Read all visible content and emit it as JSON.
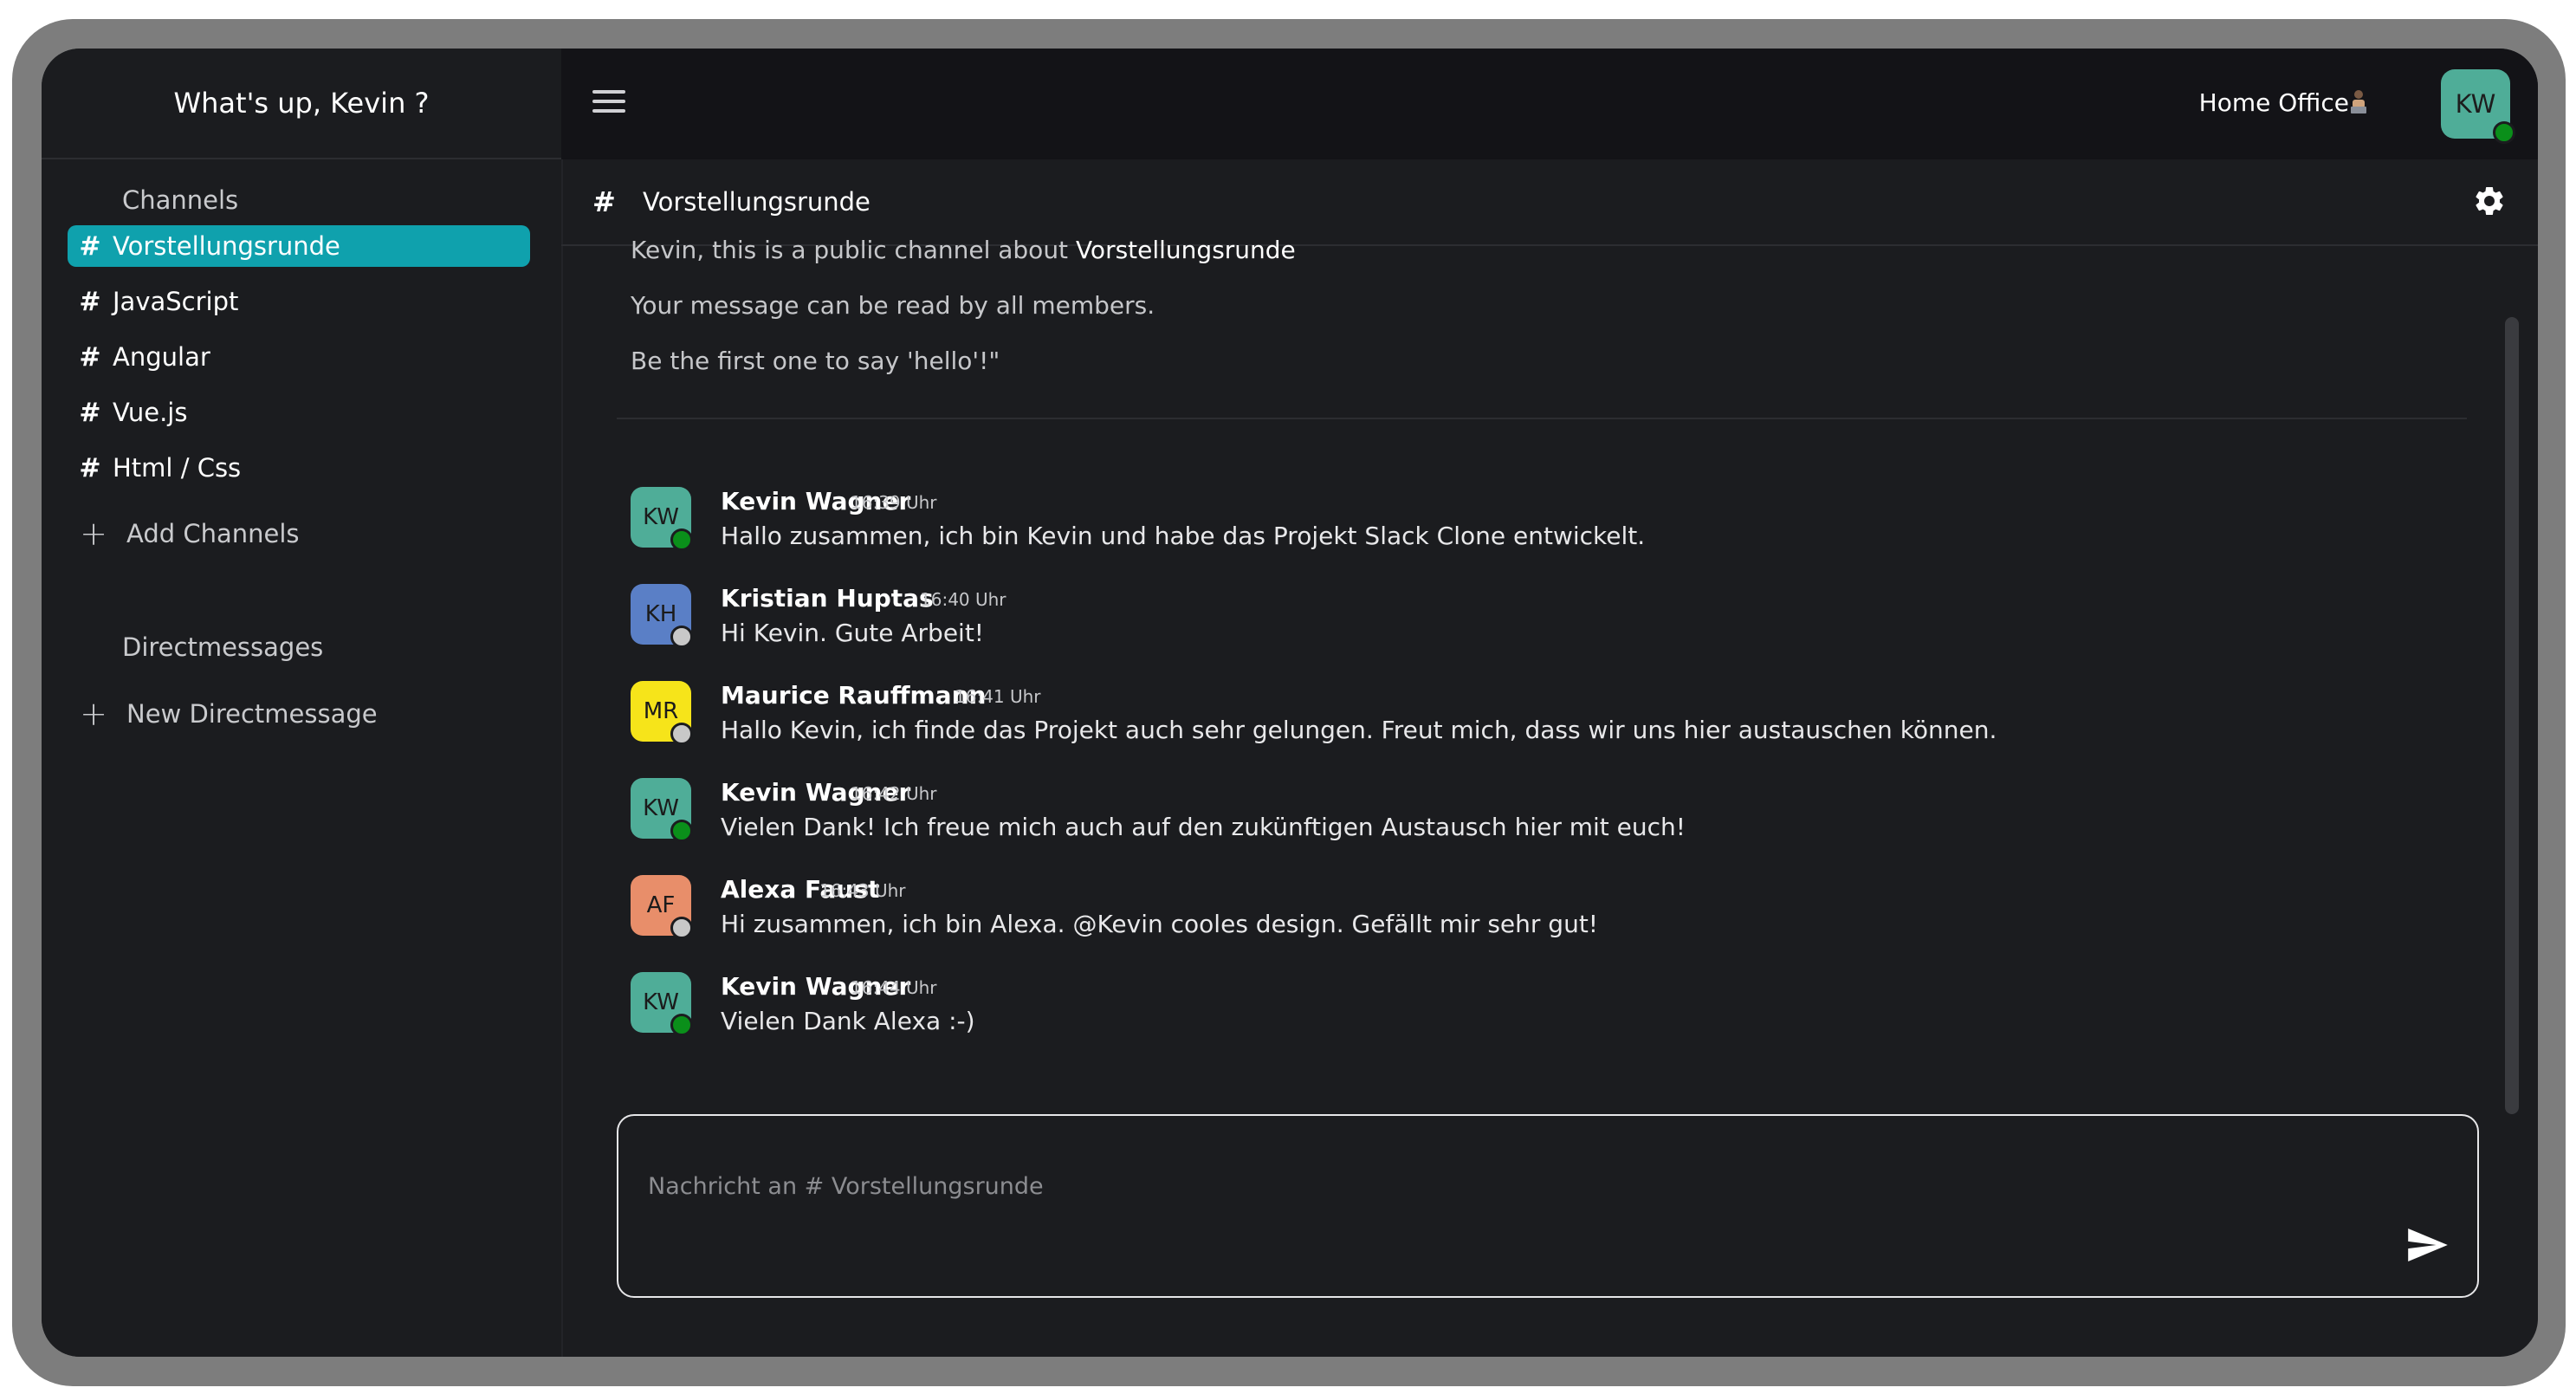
{
  "sidebar": {
    "greeting": "What's up, Kevin ?",
    "channels_title": "Channels",
    "channels": [
      {
        "label": "Vorstellungsrunde",
        "active": true
      },
      {
        "label": "JavaScript",
        "active": false
      },
      {
        "label": "Angular",
        "active": false
      },
      {
        "label": "Vue.js",
        "active": false
      },
      {
        "label": "Html / Css",
        "active": false
      }
    ],
    "add_channels_label": "Add Channels",
    "dm_title": "Directmessages",
    "new_dm_label": "New Directmessage"
  },
  "topbar": {
    "status": "Home Office",
    "status_icon": "office-worker-emoji",
    "user_initials": "KW",
    "user_presence": "online"
  },
  "channel": {
    "name": "Vorstellungsrunde",
    "intro_prefix": "Kevin, this is a public channel about",
    "intro_channel": "Vorstellungsrunde",
    "intro_line2": "Your message can be read by all members.",
    "intro_line3": "Be the first one to say 'hello'!\""
  },
  "messages": [
    {
      "initials": "KW",
      "name": "Kevin Wagner",
      "time": "16:39 Uhr",
      "text": "Hallo zusammen, ich bin Kevin und habe das Projekt Slack Clone entwickelt.",
      "color": "#4fad98",
      "presence": "online"
    },
    {
      "initials": "KH",
      "name": "Kristian Huptas",
      "time": "16:40 Uhr",
      "text": "Hi Kevin. Gute Arbeit!",
      "color": "#5a7fc6",
      "presence": "offline"
    },
    {
      "initials": "MR",
      "name": "Maurice Rauffmann",
      "time": "16:41 Uhr",
      "text": "Hallo Kevin, ich finde das Projekt auch sehr gelungen. Freut mich, dass wir uns hier austauschen können.",
      "color": "#f6e41a",
      "presence": "offline"
    },
    {
      "initials": "KW",
      "name": "Kevin Wagner",
      "time": "16:42 Uhr",
      "text": "Vielen Dank! Ich freue mich auch auf den zukünftigen Austausch hier mit euch!",
      "color": "#4fad98",
      "presence": "online"
    },
    {
      "initials": "AF",
      "name": "Alexa Faust",
      "time": "16:43 Uhr",
      "text": "Hi zusammen, ich bin Alexa. @Kevin cooles design. Gefällt mir sehr gut!",
      "color": "#e88e6a",
      "presence": "offline"
    },
    {
      "initials": "KW",
      "name": "Kevin Wagner",
      "time": "16:44 Uhr",
      "text": "Vielen Dank Alexa :-)",
      "color": "#4fad98",
      "presence": "online"
    }
  ],
  "composer": {
    "placeholder": "Nachricht an # Vorstellungsrunde",
    "value": ""
  },
  "colors": {
    "accent": "#0fa1ad",
    "online": "#0a8f1a",
    "offline": "#c8c8c8"
  }
}
